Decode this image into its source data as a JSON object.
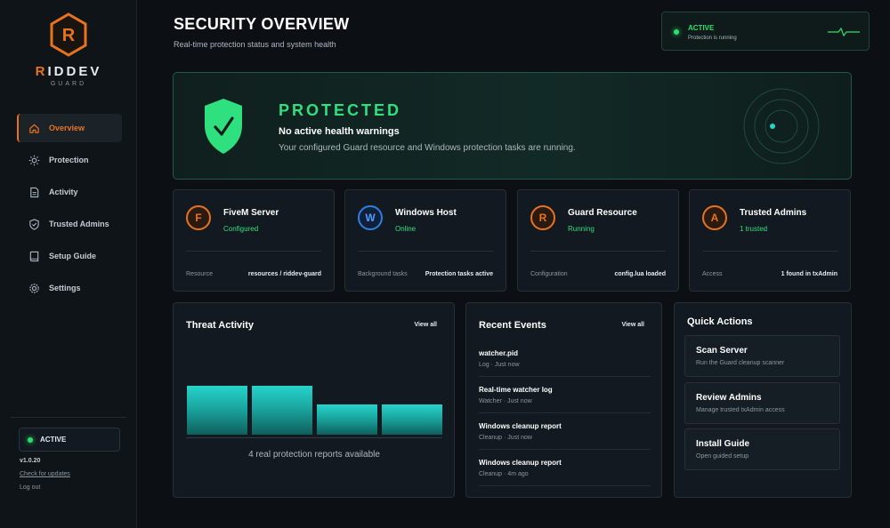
{
  "brand": {
    "name_accent": "R",
    "name_rest": "IDDEV",
    "subtitle": "GUARD",
    "logo_letter": "R",
    "accent_color": "#e8731f"
  },
  "sidebar": {
    "items": [
      {
        "label": "Overview",
        "icon": "home-icon",
        "active": true
      },
      {
        "label": "Protection",
        "icon": "sun-gear-icon",
        "active": false
      },
      {
        "label": "Activity",
        "icon": "document-icon",
        "active": false
      },
      {
        "label": "Trusted Admins",
        "icon": "shield-check-icon",
        "active": false
      },
      {
        "label": "Setup Guide",
        "icon": "book-icon",
        "active": false
      },
      {
        "label": "Settings",
        "icon": "gear-icon",
        "active": false
      }
    ],
    "status": "ACTIVE",
    "version": "v1.0.20",
    "check_updates": "Check for updates",
    "logout": "Log out"
  },
  "header": {
    "title": "SECURITY OVERVIEW",
    "subtitle": "Real-time protection status and system health"
  },
  "top_status": {
    "title": "ACTIVE",
    "subtitle": "Protection is running",
    "color": "#2ee06b"
  },
  "hero": {
    "title": "PROTECTED",
    "subtitle": "No active health warnings",
    "description": "Your configured Guard resource and Windows protection tasks are running.",
    "color": "#2ee07e"
  },
  "cards": [
    {
      "letter": "F",
      "title": "FiveM Server",
      "state": "Configured",
      "key": "Resource",
      "value": "resources / riddev-guard",
      "icon_color": "orange"
    },
    {
      "letter": "W",
      "title": "Windows Host",
      "state": "Online",
      "key": "Background tasks",
      "value": "Protection tasks active",
      "icon_color": "blue"
    },
    {
      "letter": "R",
      "title": "Guard Resource",
      "state": "Running",
      "key": "Configuration",
      "value": "config.lua loaded",
      "icon_color": "orange"
    },
    {
      "letter": "A",
      "title": "Trusted Admins",
      "state": "1 trusted",
      "key": "Access",
      "value": "1 found in txAdmin",
      "icon_color": "orange"
    }
  ],
  "threat": {
    "title": "Threat Activity",
    "view_all": "View all",
    "note": "4 real protection reports available",
    "bar_levels": [
      1.0,
      1.0,
      0.62,
      0.62
    ]
  },
  "events": {
    "title": "Recent Events",
    "view_all": "View all",
    "items": [
      {
        "title": "watcher.pid",
        "meta": "Log · Just now"
      },
      {
        "title": "Real-time watcher log",
        "meta": "Watcher · Just now"
      },
      {
        "title": "Windows cleanup report",
        "meta": "Cleanup · Just now"
      },
      {
        "title": "Windows cleanup report",
        "meta": "Cleanup · 4m ago"
      }
    ]
  },
  "quick_actions": {
    "title": "Quick Actions",
    "items": [
      {
        "title": "Scan Server",
        "subtitle": "Run the Guard cleanup scanner"
      },
      {
        "title": "Review Admins",
        "subtitle": "Manage trusted txAdmin access"
      },
      {
        "title": "Install Guide",
        "subtitle": "Open guided setup"
      }
    ]
  }
}
